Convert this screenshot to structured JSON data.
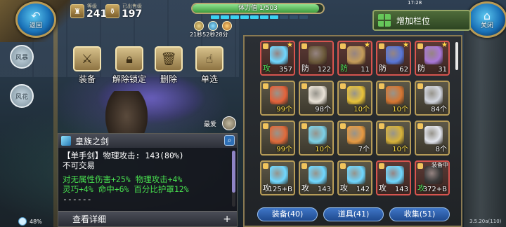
{
  "hud": {
    "back_label": "返回",
    "close_label": "关闭",
    "level_caption": "等级",
    "level_value": "241",
    "bag_caption": "已出售级",
    "bag_value": "197",
    "stamina_text": "体力值 1/503",
    "stamina_fraction": 0.97,
    "timer": "21秒52秒28分",
    "status_time": "17:28",
    "battery": "48%",
    "version": "3.5.20a(110)"
  },
  "side": {
    "btn1": "风暴",
    "btn2": "风花"
  },
  "actions": {
    "equip": "装备",
    "unlock": "解除锁定",
    "delete": "删除",
    "single": "单选"
  },
  "favorite_label": "最爱",
  "add_slot_label": "增加栏位",
  "detail": {
    "item_name": "皇族之剑",
    "line1": "【单手剑】物理攻击: 143(80%)",
    "line2": "不可交易",
    "line3": "对无属性伤害+25% 物理攻击+4%",
    "line4": "灵巧+4% 命中+6% 百分比护罩12%",
    "line5": "------",
    "view_more": "查看详细"
  },
  "inventory": {
    "slots": [
      {
        "tag": "攻",
        "value": "357",
        "color": "#6fd7ff",
        "red": true,
        "star": true,
        "lock": true,
        "tagGreen": true
      },
      {
        "tag": "防",
        "value": "122",
        "color": "#6c5a3b",
        "red": true,
        "star": false,
        "lock": true,
        "tagGreen": false
      },
      {
        "tag": "防",
        "value": "11",
        "color": "#c49c5a",
        "red": true,
        "star": true,
        "lock": true,
        "tagGreen": true
      },
      {
        "tag": "防",
        "value": "62",
        "color": "#5976d6",
        "red": true,
        "star": true,
        "lock": true,
        "tagGreen": false
      },
      {
        "tag": "防",
        "value": "31",
        "color": "#a978d8",
        "red": true,
        "star": true,
        "lock": true,
        "tagGreen": false
      },
      {
        "tag": "",
        "value": "99个",
        "color": "#e4623a",
        "red": false,
        "star": false,
        "lock": true,
        "yellow": true
      },
      {
        "tag": "",
        "value": "98个",
        "color": "#e9e2d6",
        "red": false,
        "star": false,
        "lock": true,
        "yellow": false
      },
      {
        "tag": "",
        "value": "10个",
        "color": "#e8c23a",
        "red": false,
        "star": false,
        "lock": true,
        "yellow": true
      },
      {
        "tag": "",
        "value": "10个",
        "color": "#d57632",
        "red": false,
        "star": false,
        "lock": true,
        "yellow": true
      },
      {
        "tag": "",
        "value": "84个",
        "color": "#d3d7e0",
        "red": false,
        "star": false,
        "lock": true,
        "yellow": false
      },
      {
        "tag": "",
        "value": "99个",
        "color": "#e06a3a",
        "red": false,
        "star": false,
        "lock": true,
        "yellow": true
      },
      {
        "tag": "",
        "value": "10个",
        "color": "#7cd0e6",
        "red": false,
        "star": false,
        "lock": true,
        "yellow": true
      },
      {
        "tag": "",
        "value": "7个",
        "color": "#e69a42",
        "red": false,
        "star": false,
        "lock": true,
        "yellow": false
      },
      {
        "tag": "",
        "value": "10个",
        "color": "#d7b23a",
        "red": false,
        "star": false,
        "lock": true,
        "yellow": true
      },
      {
        "tag": "",
        "value": "8个",
        "color": "#e3e6ee",
        "red": false,
        "star": false,
        "lock": true,
        "yellow": false
      },
      {
        "tag": "攻",
        "value": "125+B",
        "color": "#6fd7ff",
        "red": false,
        "star": false,
        "lock": true,
        "tagGreen": false
      },
      {
        "tag": "攻",
        "value": "143",
        "color": "#6fd7ff",
        "red": false,
        "star": false,
        "lock": true,
        "tagGreen": false
      },
      {
        "tag": "攻",
        "value": "142",
        "color": "#6fd7ff",
        "red": false,
        "star": false,
        "lock": true,
        "tagGreen": false
      },
      {
        "tag": "攻",
        "value": "143",
        "color": "#6fd7ff",
        "red": true,
        "star": false,
        "lock": true,
        "tagGreen": false
      },
      {
        "tag": "攻",
        "value": "372+B",
        "color": "#3a3a3a",
        "red": true,
        "star": false,
        "lock": true,
        "tagGreen": true,
        "equipped": "装备中"
      }
    ],
    "tabs": [
      "装备(40)",
      "道具(41)",
      "收集(51)"
    ]
  }
}
